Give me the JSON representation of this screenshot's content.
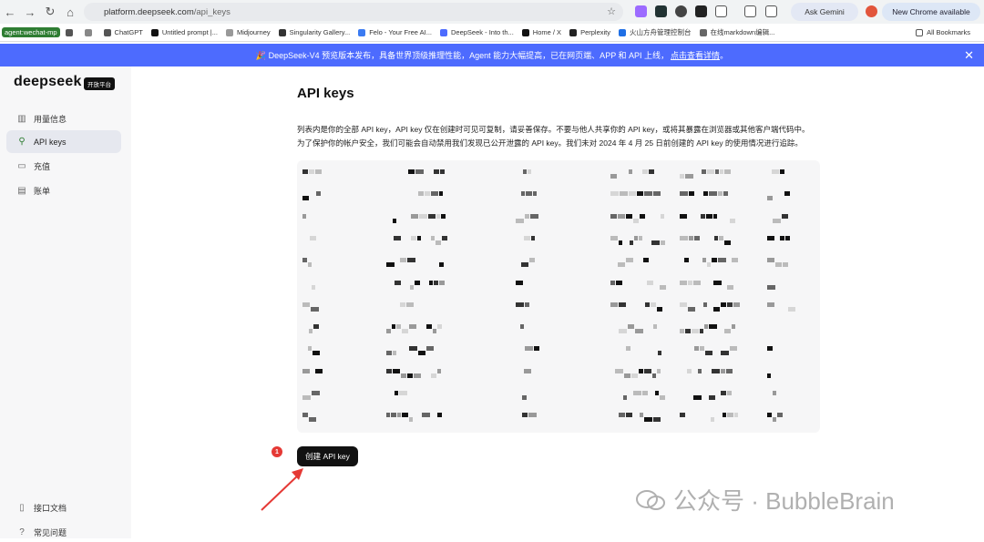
{
  "browser": {
    "url_site": "platform.deepseek.com",
    "url_path": "/api_keys",
    "ask_gemini": "Ask Gemini",
    "new_chrome": "New Chrome available",
    "bookmarks": [
      "ChatGPT",
      "Untitled prompt |...",
      "Midjourney",
      "Singularity Gallery...",
      "Felo - Your Free AI...",
      "DeepSeek - Into th...",
      "Home / X",
      "Perplexity",
      "火山方舟管理控制台",
      "在线markdown编辑..."
    ],
    "agent_tag": "agent:wechat-mp",
    "all_bookmarks": "All Bookmarks"
  },
  "banner": {
    "text": "🎉 DeepSeek-V4 预览版本发布，具备世界顶级推理性能，Agent 能力大幅提高，已在网页端、APP 和 API 上线，",
    "link": "点击查看详情",
    "tail": "。"
  },
  "sidebar": {
    "logo": "deepseek",
    "badge": "开放平台",
    "items": [
      {
        "label": "用量信息",
        "icon": "chart-icon"
      },
      {
        "label": "API keys",
        "icon": "search-icon"
      },
      {
        "label": "充值",
        "icon": "card-icon"
      },
      {
        "label": "账单",
        "icon": "bill-icon"
      }
    ],
    "footer": [
      {
        "label": "接口文档",
        "icon": "doc-icon"
      },
      {
        "label": "常见问题",
        "icon": "help-icon"
      }
    ]
  },
  "main": {
    "title": "API keys",
    "desc_line1": "列表内是你的全部 API key，API key 仅在创建时可见可复制，请妥善保存。不要与他人共享你的 API key，或将其暴露在浏览器或其他客户端代码中。",
    "desc_line2": "为了保护你的帐户安全，我们可能会自动禁用我们发现已公开泄露的 API key。我们未对 2024 年 4 月 25 日前创建的 API key 的使用情况进行追踪。",
    "create_button": "创建 API key",
    "step_badge": "1"
  },
  "watermark": "公众号 · BubbleBrain"
}
